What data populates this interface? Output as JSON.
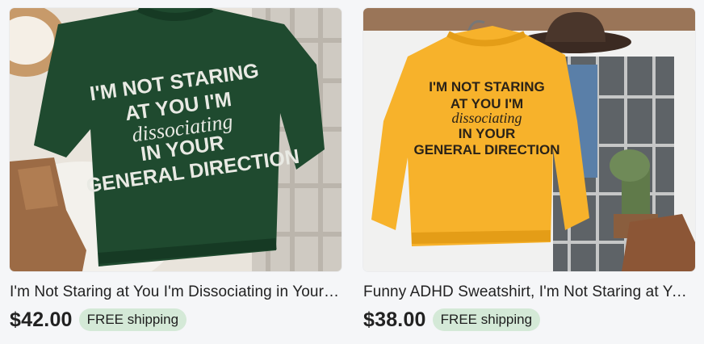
{
  "listings": [
    {
      "title": "I'm Not Staring at You I'm Dissociating in Your General Direction",
      "price": "$42.00",
      "badge": "FREE shipping",
      "shirt_color": "#1f4a2f",
      "print": {
        "line1": "I'M NOT STARING",
        "line2": "AT YOU I'M",
        "line3": "dissociating",
        "line4": "IN YOUR",
        "line5": "GENERAL DIRECTION"
      }
    },
    {
      "title": "Funny ADHD Sweatshirt, I'm Not Staring at You I'm Dissociating",
      "price": "$38.00",
      "badge": "FREE shipping",
      "shirt_color": "#f7b22b",
      "print": {
        "line1": "I'M NOT STARING",
        "line2": "AT YOU I'M",
        "line3": "dissociating",
        "line4": "IN YOUR",
        "line5": "GENERAL DIRECTION"
      }
    }
  ]
}
